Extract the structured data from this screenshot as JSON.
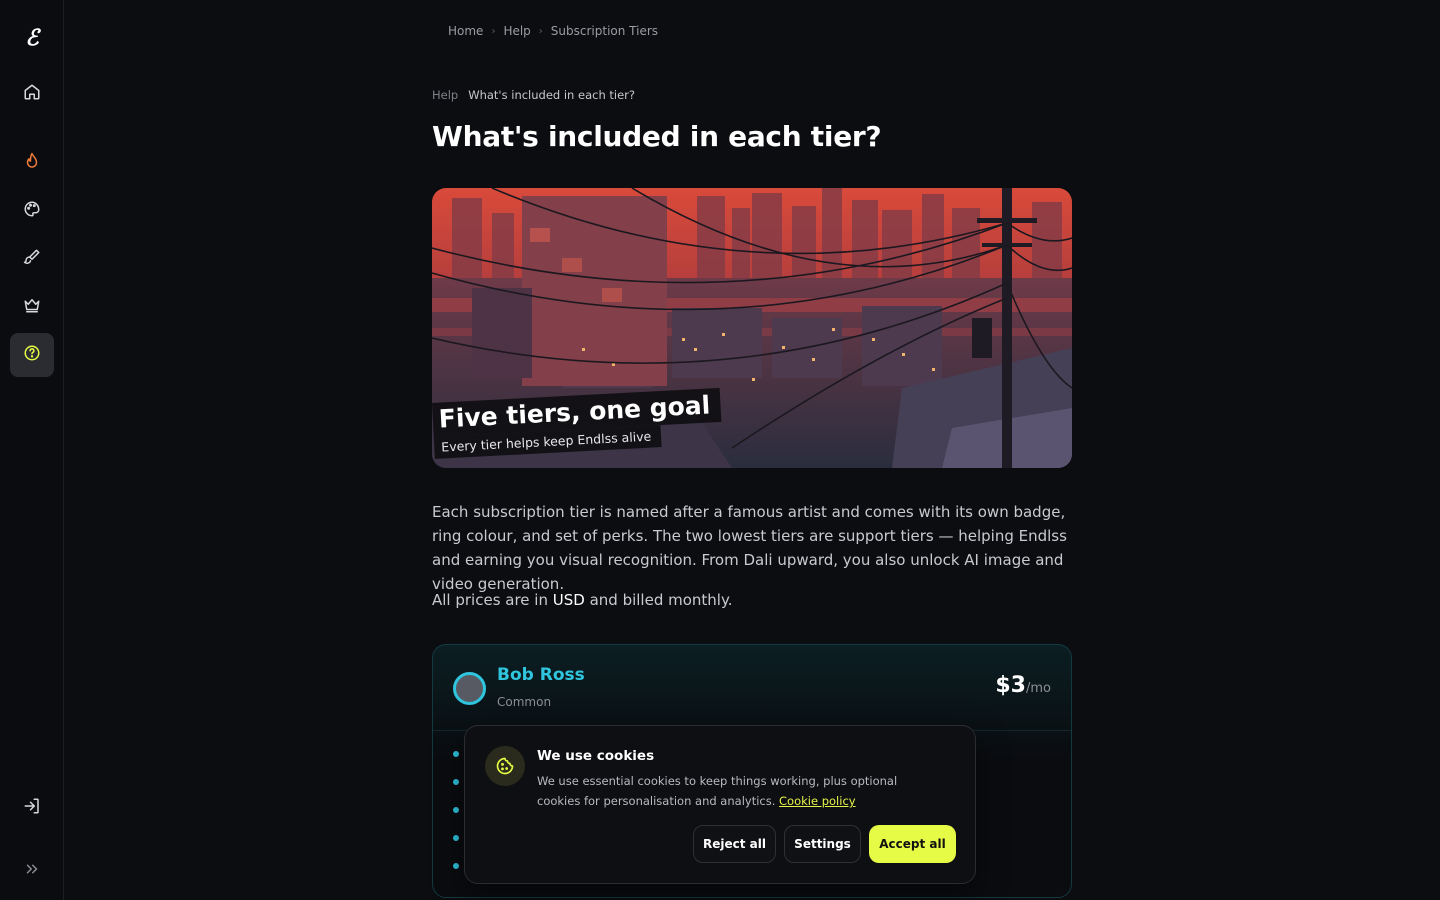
{
  "sidebar": {
    "logo": "ℰ",
    "items": [
      {
        "name": "home",
        "icon": "home-icon"
      },
      {
        "name": "trending",
        "icon": "flame-icon"
      },
      {
        "name": "palette",
        "icon": "palette-icon"
      },
      {
        "name": "create",
        "icon": "brush-icon"
      },
      {
        "name": "tiers",
        "icon": "crown-icon"
      },
      {
        "name": "help",
        "icon": "help-circle-icon",
        "active": true
      }
    ],
    "bottom": [
      {
        "name": "login",
        "icon": "login-icon"
      },
      {
        "name": "expand",
        "icon": "chevrons-right-icon"
      }
    ]
  },
  "breadcrumb": {
    "items": [
      "Home",
      "Help",
      "Subscription Tiers"
    ]
  },
  "article": {
    "crumb_parent": "Help",
    "crumb_current": "What's included in each tier?",
    "title": "What's included in each tier?",
    "hero_title": "Five tiers, one goal",
    "hero_subtitle": "Every tier helps keep Endlss alive",
    "paragraph1": "Each subscription tier is named after a famous artist and comes with its own badge, ring colour, and set of perks. The two lowest tiers are support tiers — helping Endlss and earning you visual recognition. From Dali upward, you also unlock AI image and video generation.",
    "paragraph2_prefix": "All prices are in ",
    "paragraph2_currency": "USD",
    "paragraph2_suffix": " and billed monthly."
  },
  "tier_card": {
    "name": "Bob Ross",
    "rarity": "Common",
    "price": "$3",
    "period": "/mo",
    "ring_color": "#2fc5de"
  },
  "cookie_banner": {
    "title": "We use cookies",
    "text": "We use essential cookies to keep things working, plus optional cookies for personalisation and analytics.",
    "link": "Cookie policy",
    "reject_label": "Reject all",
    "settings_label": "Settings",
    "accept_label": "Accept all",
    "accent": "#e6fb45"
  }
}
